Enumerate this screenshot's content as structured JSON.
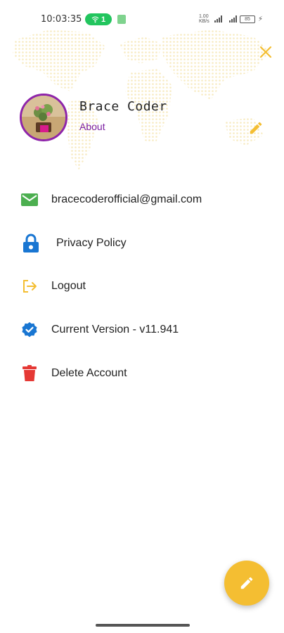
{
  "status_bar": {
    "time": "10:03:35",
    "wifi_count": "1",
    "network_speed": "1.00 KB/s",
    "battery": "85"
  },
  "profile": {
    "name": "Brace Coder",
    "about_label": "About"
  },
  "menu": [
    {
      "label": "bracecoderofficial@gmail.com",
      "icon": "email-icon",
      "color": "#4caf50"
    },
    {
      "label": "Privacy Policy",
      "icon": "lock-icon",
      "color": "#1976d2"
    },
    {
      "label": "Logout",
      "icon": "logout-icon",
      "color": "#f4be32"
    },
    {
      "label": "Current Version - v11.941",
      "icon": "verified-icon",
      "color": "#1976d2"
    },
    {
      "label": "Delete Account",
      "icon": "trash-icon",
      "color": "#e53935"
    }
  ],
  "colors": {
    "accent": "#f4be32",
    "avatar_border": "#8e24aa",
    "about_link": "#7b1fa2"
  }
}
